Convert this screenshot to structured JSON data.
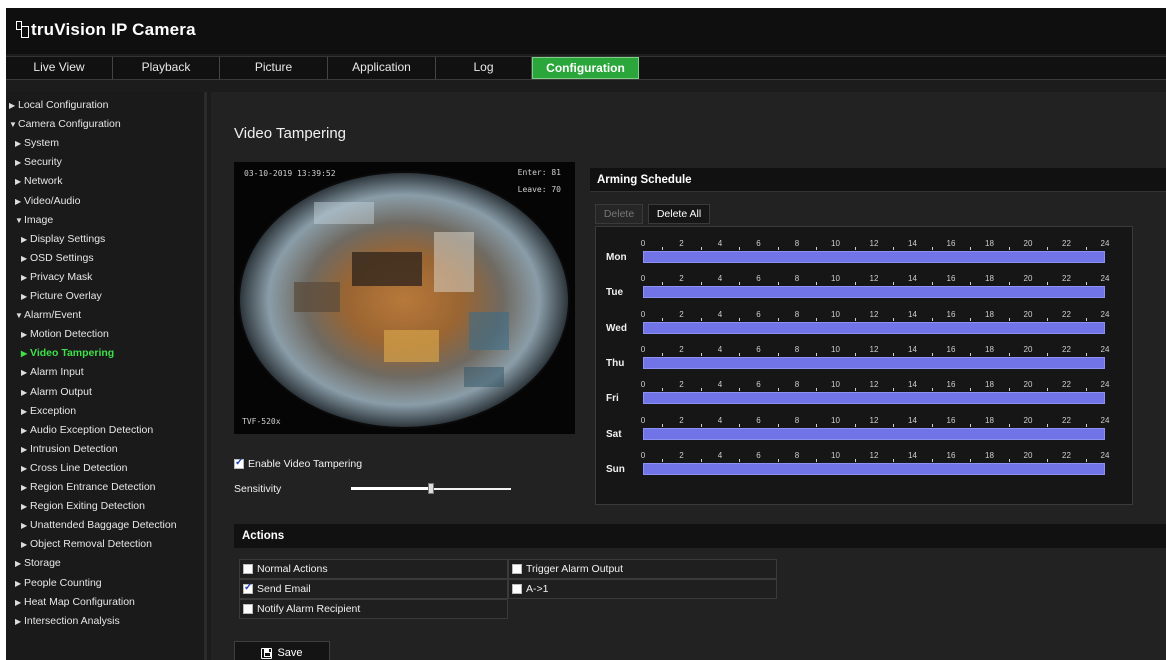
{
  "app": {
    "brand_prefix": "tru",
    "brand_name": "Vision",
    "brand_suffix": "IP Camera"
  },
  "nav": {
    "tabs": [
      {
        "label": "Live View",
        "active": false
      },
      {
        "label": "Playback",
        "active": false
      },
      {
        "label": "Picture",
        "active": false
      },
      {
        "label": "Application",
        "active": false
      },
      {
        "label": "Log",
        "active": false
      },
      {
        "label": "Configuration",
        "active": true
      }
    ]
  },
  "sidebar": {
    "items": [
      {
        "label": "Local Configuration",
        "level": 0,
        "expanded": false
      },
      {
        "label": "Camera Configuration",
        "level": 0,
        "expanded": true
      },
      {
        "label": "System",
        "level": 1,
        "expanded": false
      },
      {
        "label": "Security",
        "level": 1,
        "expanded": false
      },
      {
        "label": "Network",
        "level": 1,
        "expanded": false
      },
      {
        "label": "Video/Audio",
        "level": 1,
        "expanded": false
      },
      {
        "label": "Image",
        "level": 1,
        "expanded": true
      },
      {
        "label": "Display Settings",
        "level": 2,
        "expanded": false
      },
      {
        "label": "OSD Settings",
        "level": 2,
        "expanded": false
      },
      {
        "label": "Privacy Mask",
        "level": 2,
        "expanded": false
      },
      {
        "label": "Picture Overlay",
        "level": 2,
        "expanded": false
      },
      {
        "label": "Alarm/Event",
        "level": 1,
        "expanded": true
      },
      {
        "label": "Motion Detection",
        "level": 2,
        "expanded": false
      },
      {
        "label": "Video Tampering",
        "level": 2,
        "expanded": false,
        "active": true
      },
      {
        "label": "Alarm Input",
        "level": 2,
        "expanded": false
      },
      {
        "label": "Alarm Output",
        "level": 2,
        "expanded": false
      },
      {
        "label": "Exception",
        "level": 2,
        "expanded": false
      },
      {
        "label": "Audio Exception Detection",
        "level": 2,
        "expanded": false
      },
      {
        "label": "Intrusion Detection",
        "level": 2,
        "expanded": false
      },
      {
        "label": "Cross Line Detection",
        "level": 2,
        "expanded": false
      },
      {
        "label": "Region Entrance Detection",
        "level": 2,
        "expanded": false
      },
      {
        "label": "Region Exiting Detection",
        "level": 2,
        "expanded": false
      },
      {
        "label": "Unattended Baggage Detection",
        "level": 2,
        "expanded": false
      },
      {
        "label": "Object Removal Detection",
        "level": 2,
        "expanded": false
      },
      {
        "label": "Storage",
        "level": 1,
        "expanded": false
      },
      {
        "label": "People Counting",
        "level": 1,
        "expanded": false
      },
      {
        "label": "Heat Map Configuration",
        "level": 1,
        "expanded": false
      },
      {
        "label": "Intersection Analysis",
        "level": 1,
        "expanded": false
      }
    ]
  },
  "main": {
    "title": "Video Tampering",
    "preview": {
      "osd_time": "03-10-2019 13:39:52",
      "osd_enter": "Enter: 81",
      "osd_leave": "Leave: 70",
      "osd_model": "TVF-520x"
    },
    "enable_label": "Enable Video Tampering",
    "enable_checked": true,
    "sensitivity_label": "Sensitivity",
    "sensitivity_level": 0.5
  },
  "arming": {
    "title": "Arming Schedule",
    "delete_label": "Delete",
    "delete_all_label": "Delete All",
    "hours": [
      "0",
      "2",
      "4",
      "6",
      "8",
      "10",
      "12",
      "14",
      "16",
      "18",
      "20",
      "22",
      "24"
    ],
    "days": [
      {
        "label": "Mon",
        "start": 0,
        "end": 24
      },
      {
        "label": "Tue",
        "start": 0,
        "end": 24
      },
      {
        "label": "Wed",
        "start": 0,
        "end": 24
      },
      {
        "label": "Thu",
        "start": 0,
        "end": 24
      },
      {
        "label": "Fri",
        "start": 0,
        "end": 24
      },
      {
        "label": "Sat",
        "start": 0,
        "end": 24
      },
      {
        "label": "Sun",
        "start": 0,
        "end": 24
      }
    ]
  },
  "actions": {
    "title": "Actions",
    "normal_actions_label": "Normal Actions",
    "send_email_label": "Send Email",
    "notify_label": "Notify Alarm Recipient",
    "trigger_label": "Trigger Alarm Output",
    "output_label": "A->1",
    "normal_checked": false,
    "email_checked": true,
    "notify_checked": false,
    "trigger_checked": false,
    "output_checked": false
  },
  "save_label": "Save",
  "colors": {
    "accent_green": "#2aa63a",
    "active_menu": "#3ee04a",
    "schedule_bar": "#7074e6"
  }
}
